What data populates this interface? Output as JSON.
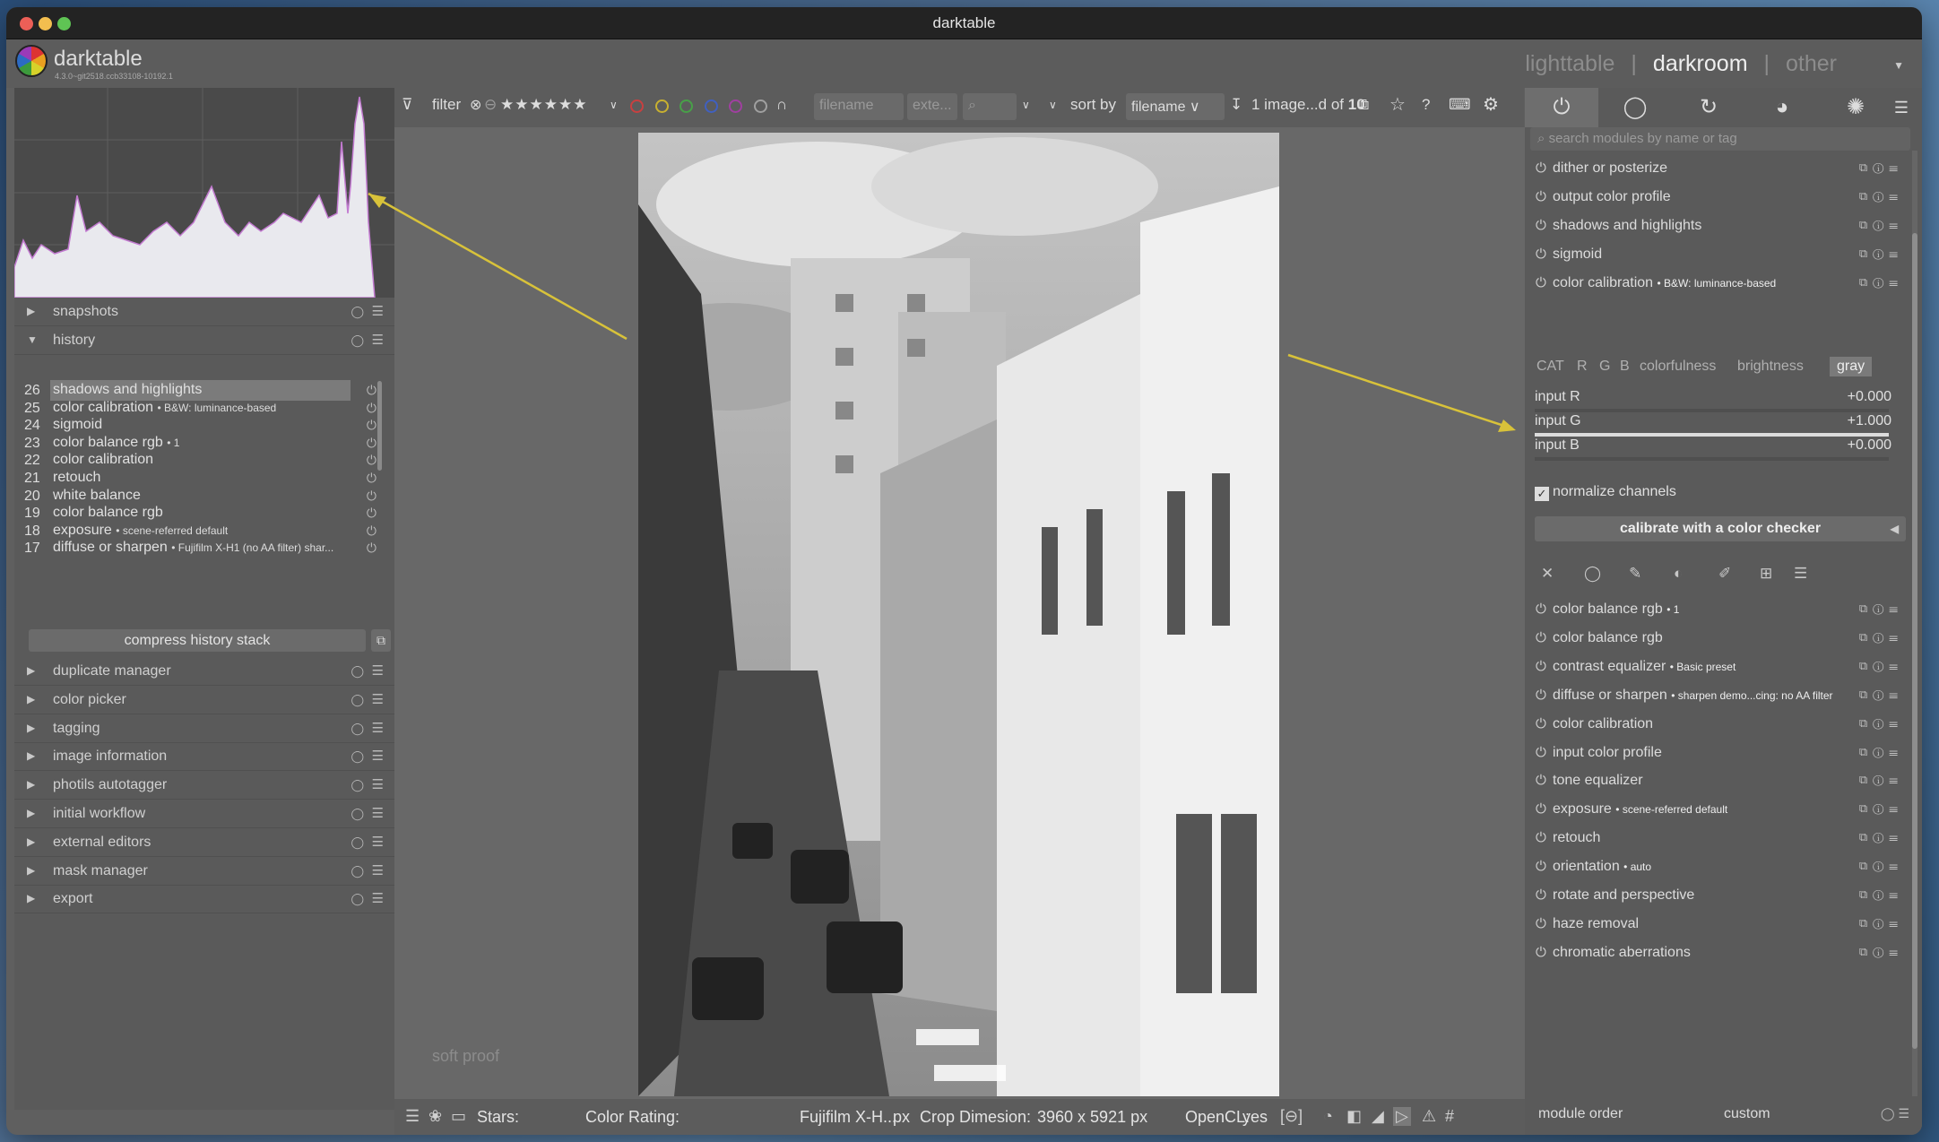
{
  "window": {
    "title": "darktable"
  },
  "header": {
    "brand": "darktable",
    "version": "4.3.0~git2518.ccb33108-10192.1",
    "views": [
      "lighttable",
      "darkroom",
      "other"
    ],
    "active_view": "darkroom",
    "separator": "|"
  },
  "left": {
    "panels_top": [
      {
        "label": "snapshots",
        "expanded": false
      },
      {
        "label": "history",
        "expanded": true
      }
    ],
    "history": [
      {
        "num": "26",
        "name": "shadows and highlights",
        "note": "",
        "selected": true
      },
      {
        "num": "25",
        "name": "color calibration",
        "note": "• B&W: luminance-based"
      },
      {
        "num": "24",
        "name": "sigmoid",
        "note": ""
      },
      {
        "num": "23",
        "name": "color balance rgb",
        "note": "• 1"
      },
      {
        "num": "22",
        "name": "color calibration",
        "note": ""
      },
      {
        "num": "21",
        "name": "retouch",
        "note": ""
      },
      {
        "num": "20",
        "name": "white balance",
        "note": ""
      },
      {
        "num": "19",
        "name": "color balance rgb",
        "note": ""
      },
      {
        "num": "18",
        "name": "exposure",
        "note": "• scene-referred default"
      },
      {
        "num": "17",
        "name": "diffuse or sharpen",
        "note": "• Fujifilm X-H1 (no AA filter) shar..."
      }
    ],
    "compress_label": "compress history stack",
    "panels_bottom": [
      "duplicate manager",
      "color picker",
      "tagging",
      "image information",
      "photils autotagger",
      "initial workflow",
      "external editors",
      "mask manager",
      "export"
    ]
  },
  "toolbar": {
    "filter_label": "filter",
    "filename_placeholder": "filename",
    "ext_placeholder": "exte...",
    "sort_label": "sort by",
    "sort_value": "filename",
    "count_text": "1 image...d of ",
    "count_total": "10",
    "rating_colors": [
      "#c84040",
      "#c8b030",
      "#48a048",
      "#4060c0",
      "#a040a0",
      "#a0a0a0"
    ]
  },
  "canvas": {
    "softproof": "soft proof"
  },
  "bottom": {
    "stars": "Stars:",
    "color_rating": "Color Rating:",
    "camera": "Fujifilm X-H...",
    "px": "px",
    "crop": "Crop Dimesion:",
    "crop_value": "3960 x 5921 px",
    "opencl": "OpenCL:",
    "opencl_value": "yes"
  },
  "right": {
    "search_placeholder": "search modules by name or tag",
    "modules_top": [
      {
        "name": "dither or posterize",
        "note": ""
      },
      {
        "name": "output color profile",
        "note": ""
      },
      {
        "name": "shadows and highlights",
        "note": ""
      },
      {
        "name": "sigmoid",
        "note": ""
      },
      {
        "name": "color calibration",
        "note": "• B&W: luminance-based"
      }
    ],
    "cc_tabs": [
      "CAT",
      "R",
      "G",
      "B",
      "colorfulness",
      "brightness",
      "gray"
    ],
    "cc_active": "gray",
    "sliders": [
      {
        "label": "input R",
        "value": "+0.000",
        "fill": 0.0
      },
      {
        "label": "input G",
        "value": "+1.000",
        "fill": 1.0
      },
      {
        "label": "input B",
        "value": "+0.000",
        "fill": 0.0
      }
    ],
    "normalize": "normalize channels",
    "calibrate_btn": "calibrate with a color checker",
    "modules_bottom": [
      {
        "name": "color balance rgb",
        "note": "• 1"
      },
      {
        "name": "color balance rgb",
        "note": ""
      },
      {
        "name": "contrast equalizer",
        "note": "• Basic preset"
      },
      {
        "name": "diffuse or sharpen",
        "note": "• sharpen demo...cing: no AA filter"
      },
      {
        "name": "color calibration",
        "note": ""
      },
      {
        "name": "input color profile",
        "note": ""
      },
      {
        "name": "tone equalizer",
        "note": ""
      },
      {
        "name": "exposure",
        "note": "• scene-referred default"
      },
      {
        "name": "retouch",
        "note": ""
      },
      {
        "name": "orientation",
        "note": "• auto"
      },
      {
        "name": "rotate and perspective",
        "note": ""
      },
      {
        "name": "haze removal",
        "note": ""
      },
      {
        "name": "chromatic aberrations",
        "note": ""
      }
    ],
    "footer_label": "module order",
    "footer_value": "custom"
  },
  "annotation_color": "#d8c23a"
}
